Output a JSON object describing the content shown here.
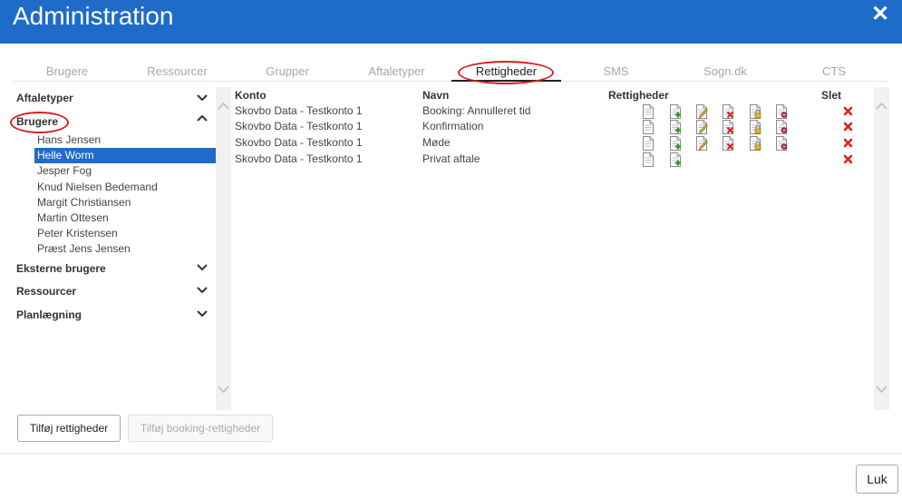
{
  "header": {
    "title": "Administration",
    "close_symbol": "✕"
  },
  "tabs": [
    {
      "label": "Brugere"
    },
    {
      "label": "Ressourcer"
    },
    {
      "label": "Grupper"
    },
    {
      "label": "Aftaletyper"
    },
    {
      "label": "Rettigheder",
      "active": true
    },
    {
      "label": "SMS"
    },
    {
      "label": "Sogn.dk"
    },
    {
      "label": "CTS"
    }
  ],
  "sidebar": {
    "categories": [
      {
        "label": "Aftaletyper",
        "expanded": false
      },
      {
        "label": "Brugere",
        "expanded": true
      },
      {
        "label": "Eksterne brugere",
        "expanded": false
      },
      {
        "label": "Ressourcer",
        "expanded": false
      },
      {
        "label": "Planlægning",
        "expanded": false
      }
    ],
    "users": [
      "Hans Jensen",
      "Helle Worm",
      "Jesper Fog",
      "Knud Nielsen Bedemand",
      "Margit Christiansen",
      "Martin Ottesen",
      "Peter Kristensen",
      "Præst Jens Jensen"
    ],
    "selected_user": "Helle Worm"
  },
  "table": {
    "columns": {
      "konto": "Konto",
      "navn": "Navn",
      "rettigheder": "Rettigheder",
      "slet": "Slet"
    },
    "rows": [
      {
        "konto": "Skovbo Data - Testkonto 1",
        "navn": "Booking: Annulleret tid",
        "rights": [
          "view-doc-icon",
          "add-doc-icon",
          "edit-doc-icon",
          "delete-doc-icon",
          "lock-doc-icon",
          "permission-doc-icon"
        ]
      },
      {
        "konto": "Skovbo Data - Testkonto 1",
        "navn": "Konfirmation",
        "rights": [
          "view-doc-icon",
          "add-doc-icon",
          "edit-doc-icon",
          "delete-doc-icon",
          "lock-doc-icon",
          "permission-doc-icon"
        ]
      },
      {
        "konto": "Skovbo Data - Testkonto 1",
        "navn": "Møde",
        "rights": [
          "view-doc-icon",
          "add-doc-icon",
          "edit-doc-icon",
          "delete-doc-icon",
          "lock-doc-icon",
          "permission-doc-icon"
        ]
      },
      {
        "konto": "Skovbo Data - Testkonto 1",
        "navn": "Privat aftale",
        "rights": [
          "view-doc-icon",
          "add-doc-icon"
        ]
      }
    ]
  },
  "buttons": {
    "add_rights": "Tilføj rettigheder",
    "add_booking_rights": "Tilføj booking-rettigheder",
    "close": "Luk"
  },
  "colors": {
    "header_blue": "#1f6bc9",
    "selection_blue": "#1f6bc9",
    "annotation_red": "#d42020",
    "delete_red": "#e02020"
  }
}
